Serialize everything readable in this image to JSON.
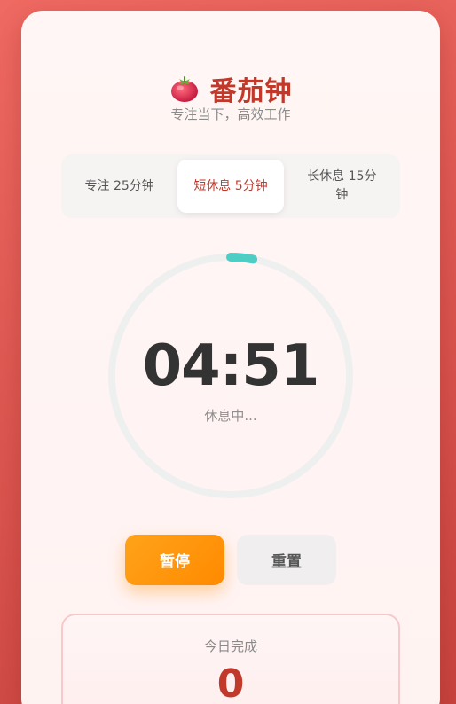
{
  "app": {
    "title": "番茄钟",
    "subtitle": "专注当下，高效工作",
    "logo_icon": "tomato-icon"
  },
  "modes": {
    "items": [
      {
        "label": "专注 25分钟"
      },
      {
        "label": "短休息 5分钟"
      },
      {
        "label": "长休息 15分钟"
      }
    ],
    "active_index": 1
  },
  "timer": {
    "time": "04:51",
    "status": "休息中...",
    "progress": 0.03,
    "ring_color": "#4ecdc4",
    "track_color": "#eef0ef"
  },
  "controls": {
    "pause_label": "暂停",
    "reset_label": "重置"
  },
  "stats": {
    "label": "今日完成",
    "value": "0"
  },
  "colors": {
    "accent": "#c0392b",
    "button_orange": "#ff8a00"
  }
}
